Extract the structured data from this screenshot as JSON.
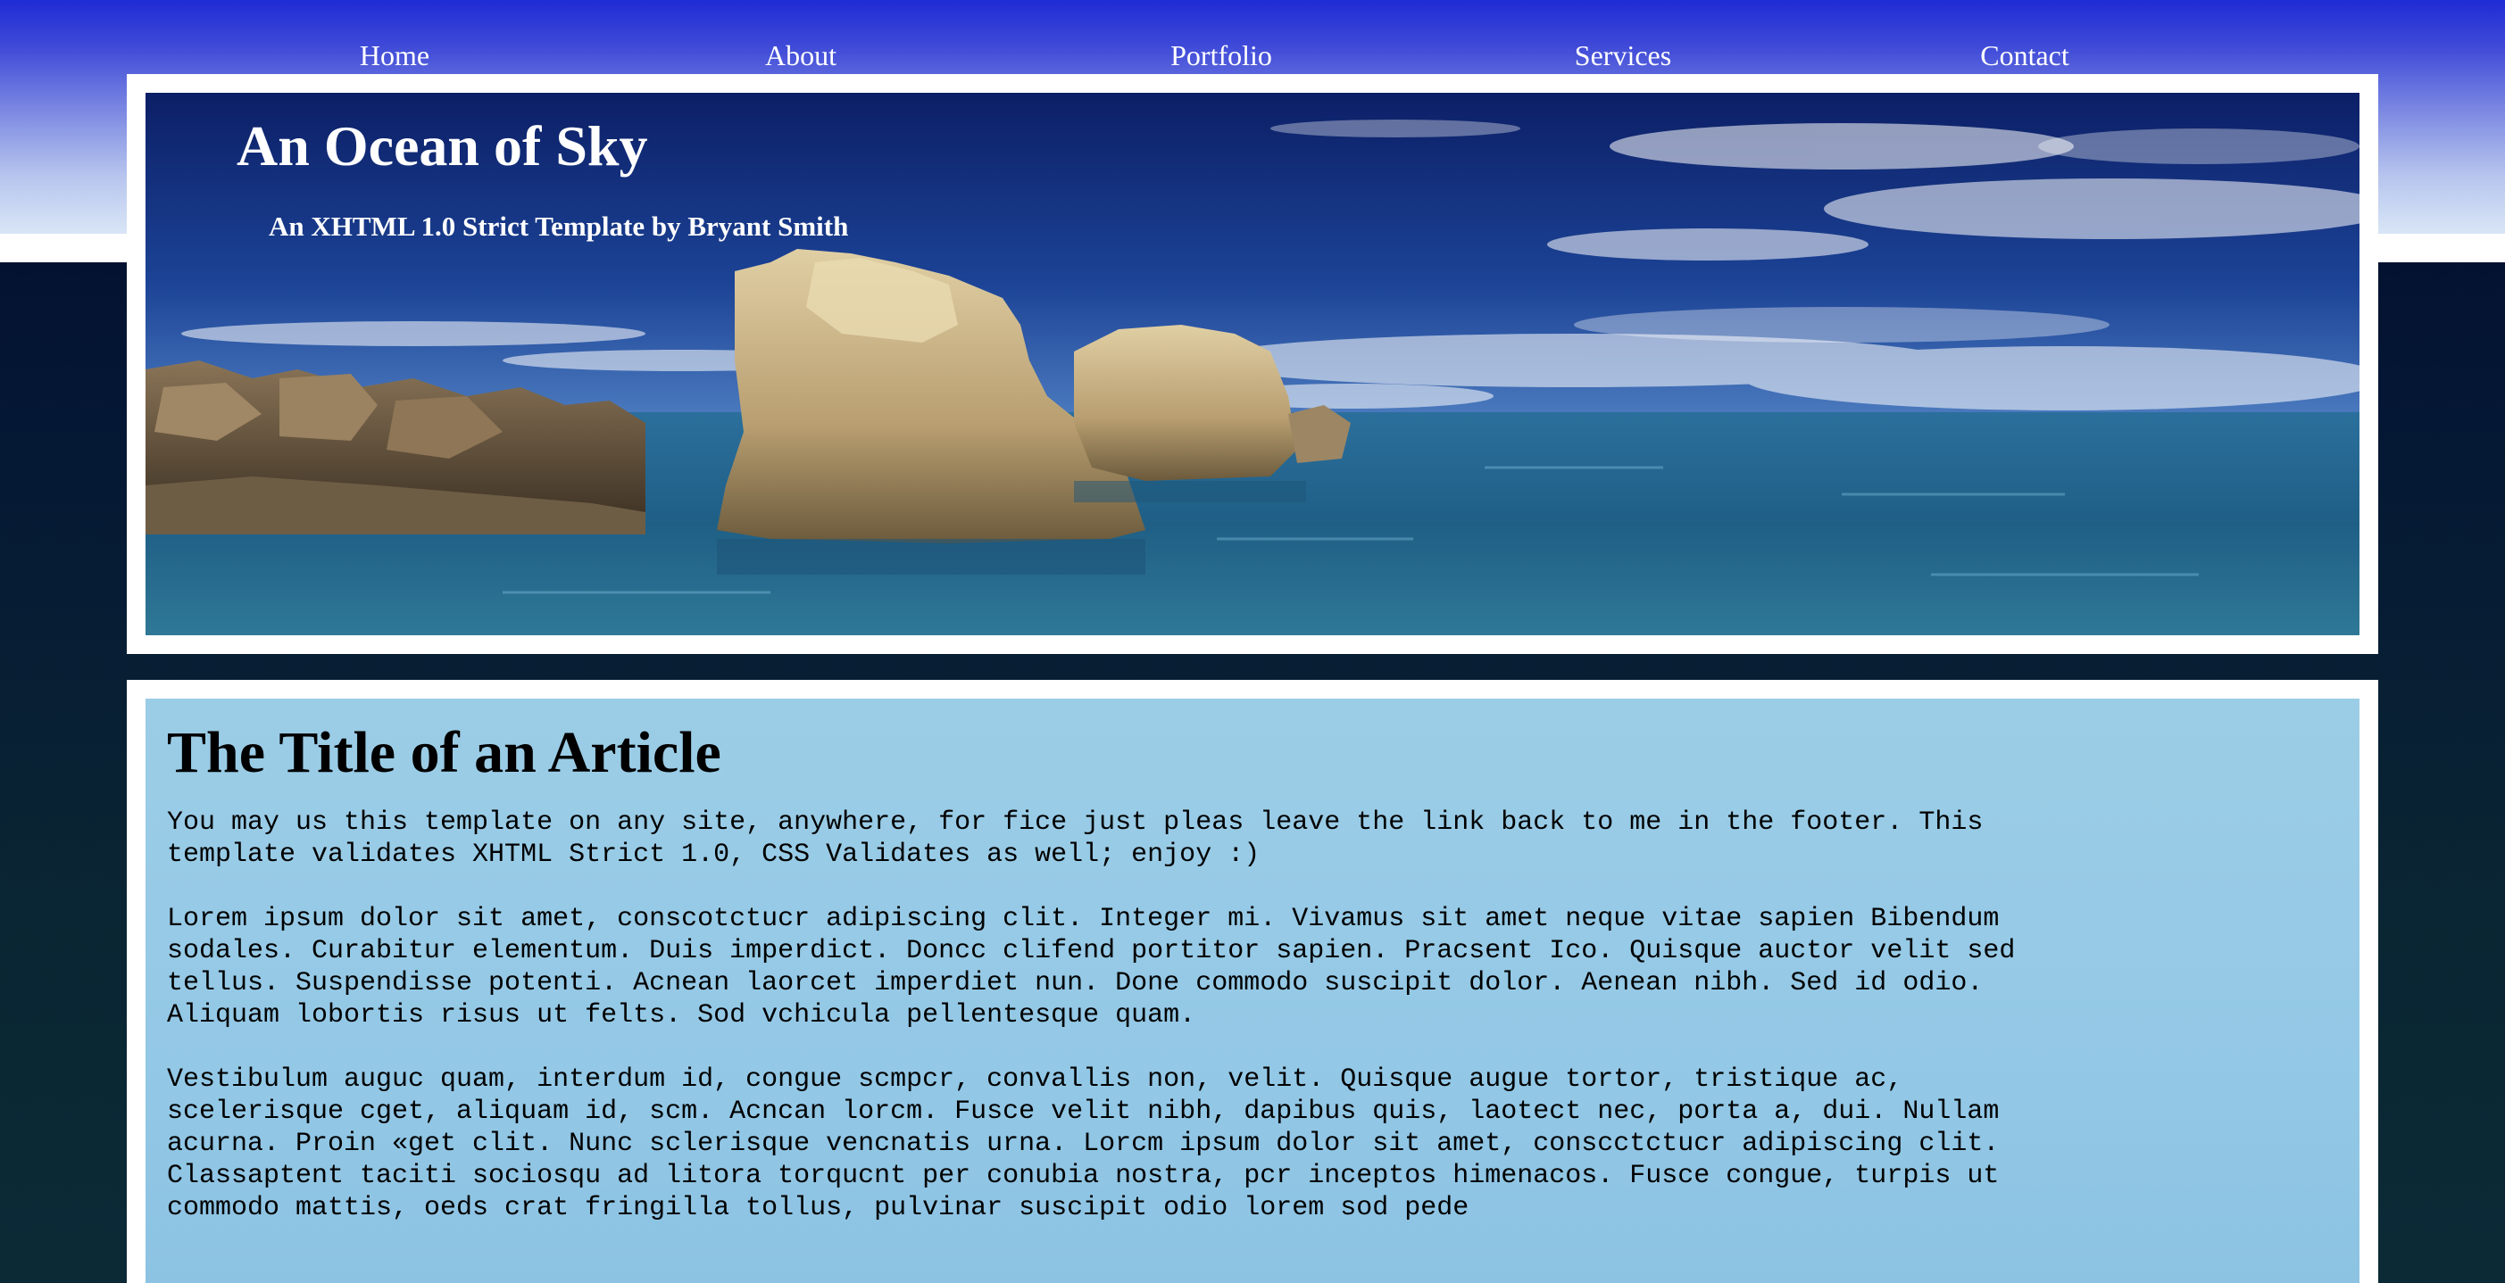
{
  "nav": {
    "items": [
      {
        "label": "Home"
      },
      {
        "label": "About"
      },
      {
        "label": "Portfolio"
      },
      {
        "label": "Services"
      },
      {
        "label": "Contact"
      }
    ]
  },
  "header": {
    "title": "An Ocean of Sky",
    "subtitle": "An XHTML 1.0 Strict Template by Bryant Smith"
  },
  "article": {
    "title": "The Title of an Article",
    "paragraphs": [
      {
        "lines": [
          "You may us this template on any site, anywhere, for fice just pleas leave the link back to me in the footer. This",
          "template validates XHTML Strict 1.0, CSS Validates as well; enjoy :)"
        ]
      },
      {
        "lines": [
          "Lorem ipsum dolor sit amet, conscotctucr adipiscing clit. Integer mi. Vivamus sit amet neque vitae sapien Bibendum",
          "sodales. Curabitur elementum. Duis imperdict. Doncc clifend portitor sapien. Pracsent Ico. Quisque auctor velit sed",
          "tellus. Suspendisse potenti. Acnean laorcet imperdiet nun. Done commodo suscipit dolor. Aenean nibh. Sed id odio.",
          "Aliquam lobortis risus ut felts. Sod vchicula pellentesque quam."
        ]
      },
      {
        "lines": [
          "Vestibulum auguc quam, interdum id, congue scmpcr, convallis non, velit. Quisque augue tortor, tristique ac,",
          "scelerisque cget, aliquam id, scm. Acncan lorcm. Fusce velit nibh, dapibus quis, laotect nec, porta a, dui. Nullam",
          "acurna. Proin «get clit. Nunc sclerisque vencnatis urna. Lorcm ipsum dolor sit amet, conscctctucr adipiscing clit.",
          "Classaptent taciti sociosqu ad litora torqucnt per conubia nostra, pcr inceptos himenacos. Fusce congue, turpis ut",
          "commodo mattis, oeds crat fringilla tollus, pulvinar suscipit odio lorem sod pede"
        ]
      }
    ]
  },
  "colors": {
    "nav_gradient_top": "#1f2bd4",
    "page_background": "#041634",
    "content_background": "#93c8e6",
    "frame": "#ffffff"
  }
}
